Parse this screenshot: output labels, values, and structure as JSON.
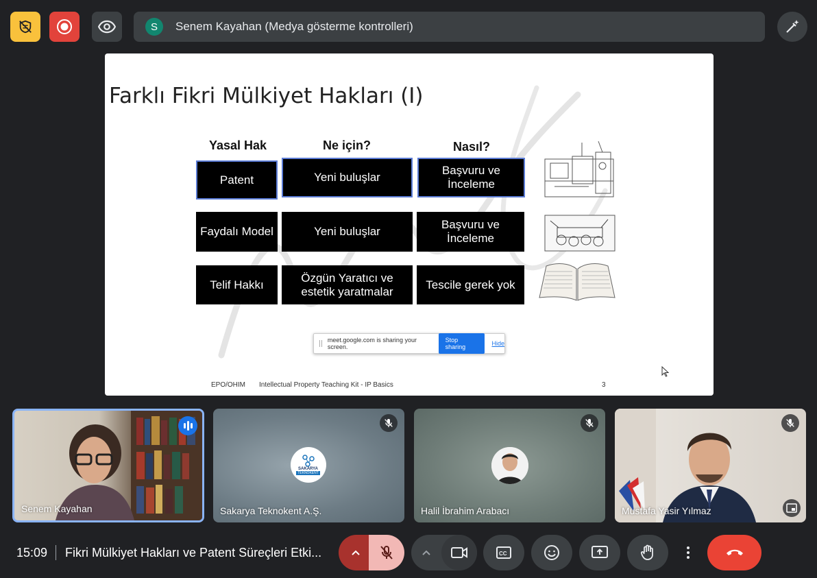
{
  "top_bar": {
    "presenter_initial": "S",
    "presenter_label": "Senem Kayahan (Medya gösterme kontrolleri)"
  },
  "slide": {
    "title": "Farklı Fikri Mülkiyet Hakları (I)",
    "column_headers": [
      "Yasal Hak",
      "Ne için?",
      "Nasıl?"
    ],
    "rows": [
      [
        "Patent",
        "Yeni buluşlar",
        "Başvuru ve İnceleme"
      ],
      [
        "Faydalı Model",
        "Yeni buluşlar",
        "Başvuru ve İnceleme"
      ],
      [
        "Telif Hakkı",
        "Özgün Yaratıcı ve estetik yaratmalar",
        "Tescile gerek yok"
      ]
    ],
    "share_bar": {
      "message": "meet.google.com is sharing your screen.",
      "stop_label": "Stop sharing",
      "hide_label": "Hide"
    },
    "footer_left": "EPO/OHIM",
    "footer_center": "Intellectual Property Teaching Kit - IP Basics",
    "page_number": "3"
  },
  "participants": [
    {
      "name": "Senem Kayahan",
      "speaking": true
    },
    {
      "name": "Sakarya Teknokent A.Ş.",
      "muted": true,
      "logo_text": "SAKARYA",
      "logo_subtext": "TEKNOKENT"
    },
    {
      "name": "Halil İbrahim Arabacı",
      "muted": true
    },
    {
      "name": "Mustafa Yasir Yılmaz",
      "muted": true
    }
  ],
  "bottom_bar": {
    "time": "15:09",
    "meeting_title": "Fikri Mülkiyet Hakları ve Patent Süreçleri Etki..."
  },
  "colors": {
    "background": "#202124",
    "control": "#3c4043",
    "end_call": "#ea4335",
    "mic_off_active": "#f2b8b5",
    "record": "#e2433b",
    "host_controls": "#f9c13c",
    "presenter_avatar": "#12866f"
  },
  "icons": {
    "host_controls": "shield-crossed-icon",
    "record": "record-icon",
    "visibility": "eye-icon",
    "annotate": "pen-sparkle-icon",
    "mic_muted": "mic-off-icon",
    "camera": "videocam-icon",
    "captions": "closed-caption-icon",
    "reactions": "emoji-icon",
    "present": "present-screen-icon",
    "raise_hand": "hand-icon",
    "more": "more-vert-icon",
    "end_call": "call-end-icon"
  }
}
